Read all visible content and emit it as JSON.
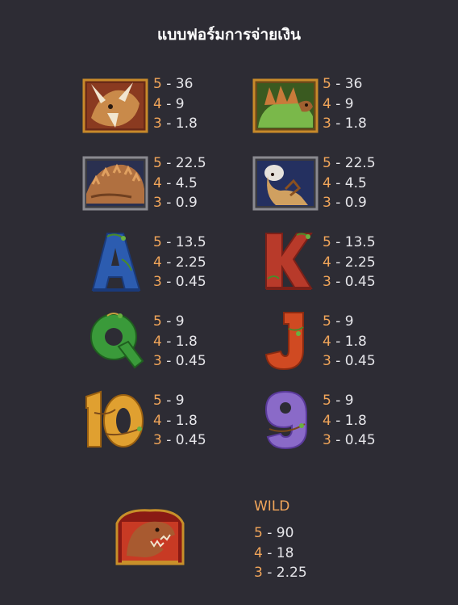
{
  "title": "แบบฟอร์มการจ่ายเงิน",
  "colors": {
    "background": "#2d2c34",
    "text": "#e6e6ea",
    "accent": "#f2a65a"
  },
  "symbols": [
    {
      "icon": "triceratops-icon",
      "pays": [
        {
          "count": "5",
          "value": "36"
        },
        {
          "count": "4",
          "value": "9"
        },
        {
          "count": "3",
          "value": "1.8"
        }
      ]
    },
    {
      "icon": "stegosaurus-icon",
      "pays": [
        {
          "count": "5",
          "value": "36"
        },
        {
          "count": "4",
          "value": "9"
        },
        {
          "count": "3",
          "value": "1.8"
        }
      ]
    },
    {
      "icon": "ankylosaurus-icon",
      "pays": [
        {
          "count": "5",
          "value": "22.5"
        },
        {
          "count": "4",
          "value": "4.5"
        },
        {
          "count": "3",
          "value": "0.9"
        }
      ]
    },
    {
      "icon": "pachycephalosaurus-icon",
      "pays": [
        {
          "count": "5",
          "value": "22.5"
        },
        {
          "count": "4",
          "value": "4.5"
        },
        {
          "count": "3",
          "value": "0.9"
        }
      ]
    },
    {
      "icon": "letter-a-icon",
      "pays": [
        {
          "count": "5",
          "value": "13.5"
        },
        {
          "count": "4",
          "value": "2.25"
        },
        {
          "count": "3",
          "value": "0.45"
        }
      ]
    },
    {
      "icon": "letter-k-icon",
      "pays": [
        {
          "count": "5",
          "value": "13.5"
        },
        {
          "count": "4",
          "value": "2.25"
        },
        {
          "count": "3",
          "value": "0.45"
        }
      ]
    },
    {
      "icon": "letter-q-icon",
      "pays": [
        {
          "count": "5",
          "value": "9"
        },
        {
          "count": "4",
          "value": "1.8"
        },
        {
          "count": "3",
          "value": "0.45"
        }
      ]
    },
    {
      "icon": "letter-j-icon",
      "pays": [
        {
          "count": "5",
          "value": "9"
        },
        {
          "count": "4",
          "value": "1.8"
        },
        {
          "count": "3",
          "value": "0.45"
        }
      ]
    },
    {
      "icon": "number-10-icon",
      "pays": [
        {
          "count": "5",
          "value": "9"
        },
        {
          "count": "4",
          "value": "1.8"
        },
        {
          "count": "3",
          "value": "0.45"
        }
      ]
    },
    {
      "icon": "number-9-icon",
      "pays": [
        {
          "count": "5",
          "value": "9"
        },
        {
          "count": "4",
          "value": "1.8"
        },
        {
          "count": "3",
          "value": "0.45"
        }
      ]
    }
  ],
  "wild": {
    "label": "WILD",
    "icon": "t-rex-wild-icon",
    "pays": [
      {
        "count": "5",
        "value": "90"
      },
      {
        "count": "4",
        "value": "18"
      },
      {
        "count": "3",
        "value": "2.25"
      }
    ]
  }
}
